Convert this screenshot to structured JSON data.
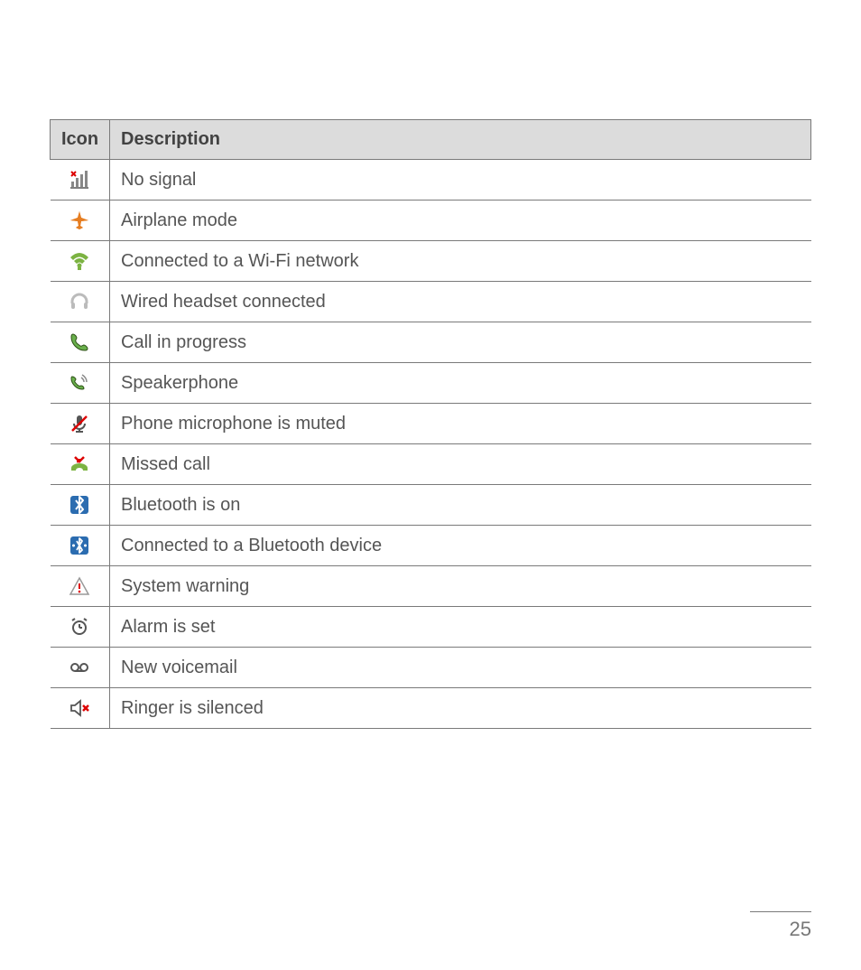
{
  "table": {
    "headers": {
      "icon": "Icon",
      "description": "Description"
    },
    "rows": [
      {
        "icon": "no-signal-icon",
        "description": "No signal"
      },
      {
        "icon": "airplane-mode-icon",
        "description": "Airplane mode"
      },
      {
        "icon": "wifi-connected-icon",
        "description": "Connected to a Wi-Fi network"
      },
      {
        "icon": "headset-icon",
        "description": "Wired headset connected"
      },
      {
        "icon": "call-in-progress-icon",
        "description": "Call in progress"
      },
      {
        "icon": "speakerphone-icon",
        "description": "Speakerphone"
      },
      {
        "icon": "mic-muted-icon",
        "description": "Phone microphone is muted"
      },
      {
        "icon": "missed-call-icon",
        "description": "Missed call"
      },
      {
        "icon": "bluetooth-on-icon",
        "description": "Bluetooth is on"
      },
      {
        "icon": "bluetooth-connected-icon",
        "description": "Connected to a Bluetooth device"
      },
      {
        "icon": "system-warning-icon",
        "description": "System warning"
      },
      {
        "icon": "alarm-set-icon",
        "description": "Alarm is set"
      },
      {
        "icon": "voicemail-icon",
        "description": "New voicemail"
      },
      {
        "icon": "ringer-silenced-icon",
        "description": "Ringer is silenced"
      }
    ]
  },
  "page_number": "25"
}
